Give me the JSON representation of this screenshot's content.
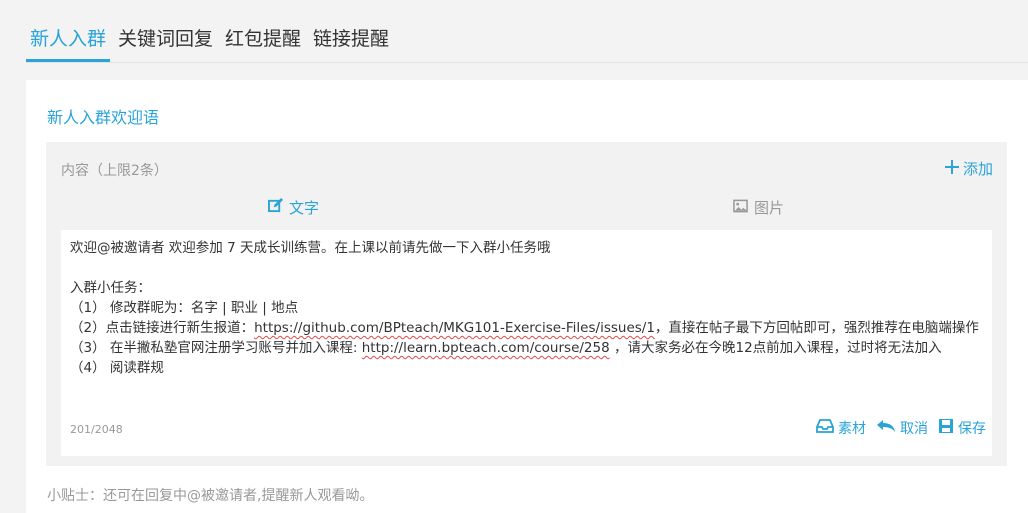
{
  "tabs": [
    {
      "label": "新人入群"
    },
    {
      "label": "关键词回复"
    },
    {
      "label": "红包提醒"
    },
    {
      "label": "链接提醒"
    }
  ],
  "section_title": "新人入群欢迎语",
  "panel": {
    "label": "内容（上限2条）",
    "add_label": "添加",
    "type_tabs": {
      "text": "文字",
      "image": "图片"
    }
  },
  "editor": {
    "line1": "欢迎@被邀请者 欢迎参加 7 天成长训练营。在上课以前请先做一下入群小任务哦",
    "line2": "入群小任务：",
    "line3": "（1） 修改群昵为：名字 | 职业 | 地点",
    "line4_pre": "（2）点击链接进行新生报道：",
    "line4_link": "https://github.com/BPteach/MKG101-Exercise-Files/issues/1",
    "line4_post": "，直接在帖子最下方回帖即可，强烈推荐在电脑端操作",
    "line5_pre": "（3） 在半撇私塾官网注册学习账号并加入课程: ",
    "line5_link": "http://learn.bpteach.com/course/258",
    "line5_post": " ，请大家务必在今晚12点前加入课程，过时将无法加入",
    "line6": "（4） 阅读群规",
    "counter": "201/2048",
    "actions": {
      "material": "素材",
      "cancel": "取消",
      "save": "保存"
    }
  },
  "tip": "小贴士：还可在回复中@被邀请者,提醒新人观看呦。",
  "colors": {
    "accent": "#29a3d8"
  }
}
